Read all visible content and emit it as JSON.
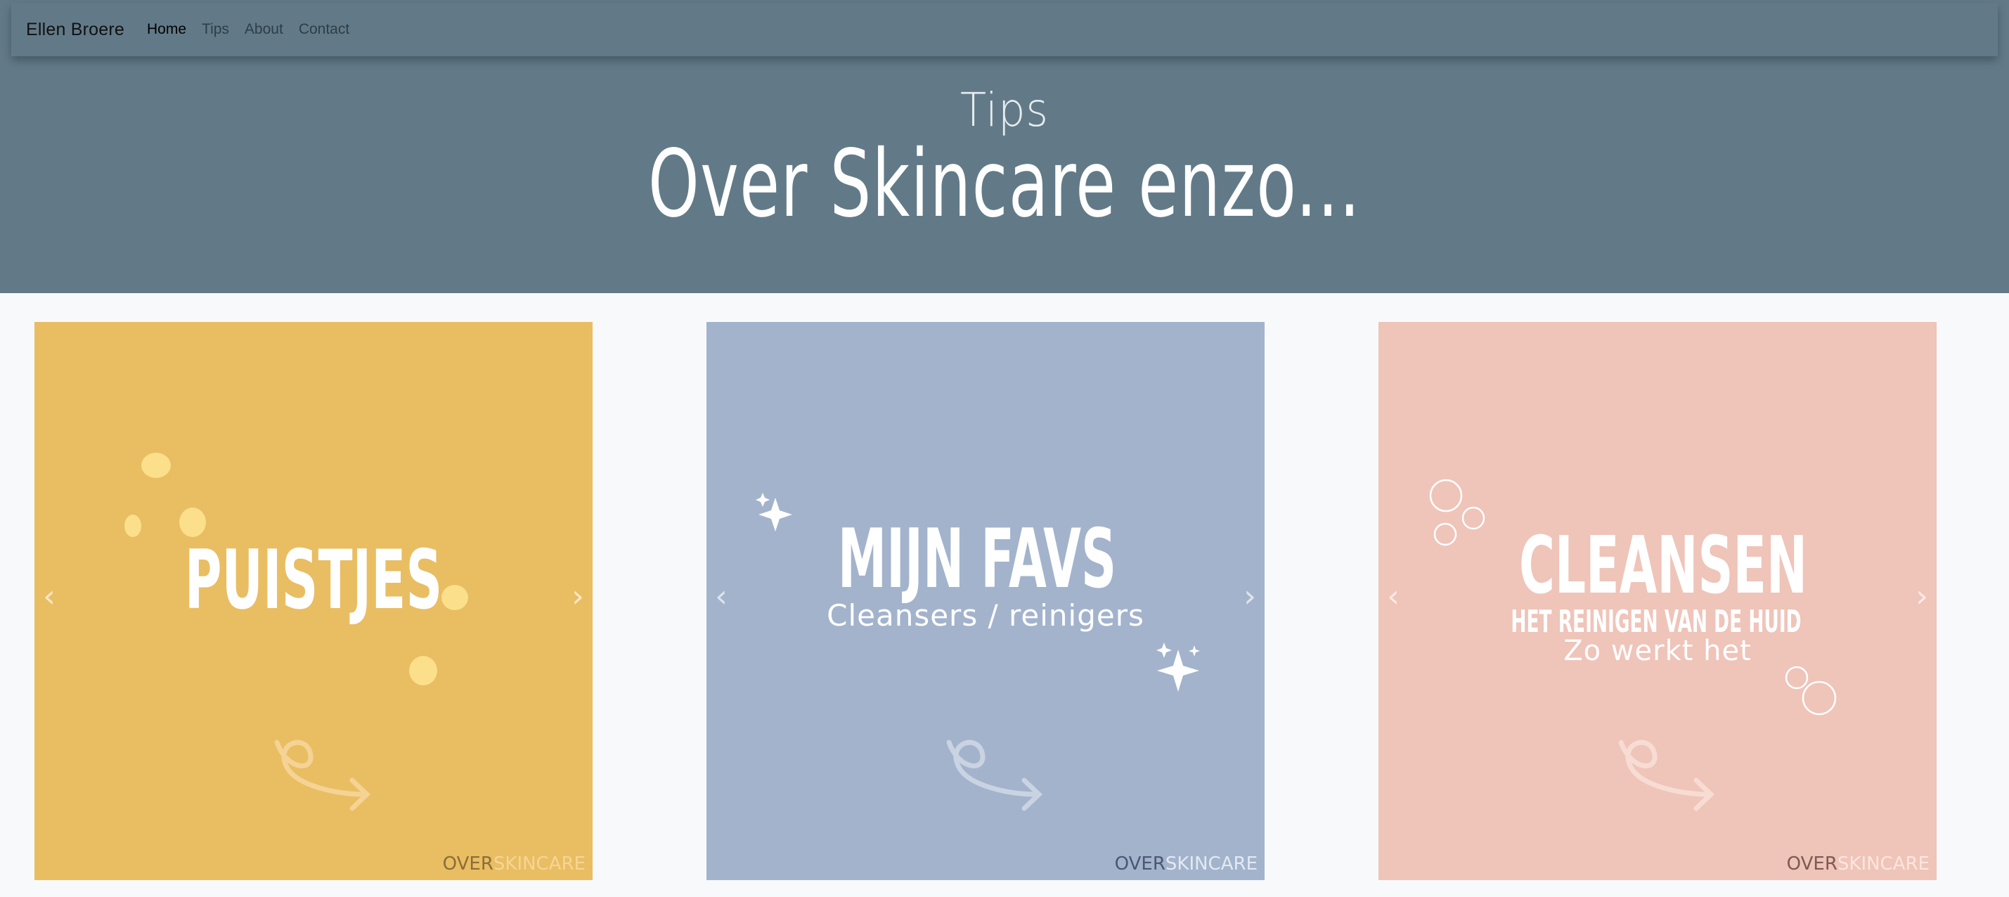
{
  "navbar": {
    "brand": "Ellen Broere",
    "links": [
      {
        "label": "Home",
        "active": true
      },
      {
        "label": "Tips",
        "active": false
      },
      {
        "label": "About",
        "active": false
      },
      {
        "label": "Contact",
        "active": false
      }
    ]
  },
  "hero": {
    "subtitle": "Tips",
    "title": "Over Skincare enzo..."
  },
  "cards": [
    {
      "title": "Puistjes",
      "subtitle": "",
      "subtitle2": "",
      "color": "#e9bd62",
      "brand_over": "OVER",
      "brand_skincare": "SKINCARE"
    },
    {
      "title": "Mijn favs",
      "subtitle": "Cleansers / reinigers",
      "subtitle2": "",
      "color": "#a3b3cc",
      "brand_over": "OVER",
      "brand_skincare": "SKINCARE"
    },
    {
      "title": "Cleansen",
      "subtitle": "Het reinigen van de huid",
      "subtitle2": "Zo werkt het",
      "color": "#efc4b9",
      "brand_over": "OVER",
      "brand_skincare": "SKINCARE"
    }
  ],
  "carousel": {
    "prev_icon": "chevron-left-icon",
    "next_icon": "chevron-right-icon"
  }
}
